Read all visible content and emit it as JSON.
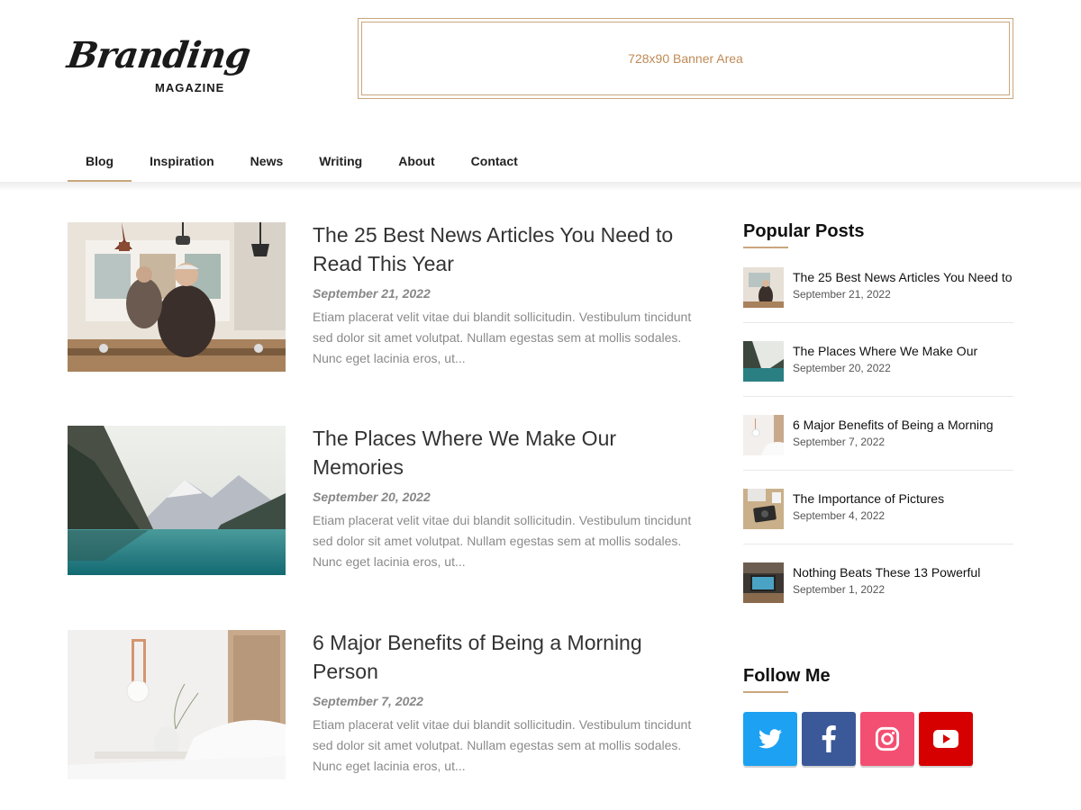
{
  "header": {
    "logo_script": "Branding",
    "logo_sub": "MAGAZINE",
    "banner_text": "728x90 Banner Area"
  },
  "nav": {
    "items": [
      {
        "label": "Blog",
        "active": true
      },
      {
        "label": "Inspiration"
      },
      {
        "label": "News"
      },
      {
        "label": "Writing"
      },
      {
        "label": "About"
      },
      {
        "label": "Contact"
      }
    ]
  },
  "posts": [
    {
      "title": "The 25 Best News Articles You Need to Read This Year",
      "date": "September 21, 2022",
      "excerpt": "Etiam placerat velit vitae dui blandit sollicitudin. Vestibulum tincidunt sed dolor sit amet volutpat. Nullam egestas sem at mollis sodales. Nunc eget lacinia eros, ut..."
    },
    {
      "title": "The Places Where We Make Our Memories",
      "date": "September 20, 2022",
      "excerpt": "Etiam placerat velit vitae dui blandit sollicitudin. Vestibulum tincidunt sed dolor sit amet volutpat. Nullam egestas sem at mollis sodales. Nunc eget lacinia eros, ut..."
    },
    {
      "title": "6 Major Benefits of Being a Morning Person",
      "date": "September 7, 2022",
      "excerpt": "Etiam placerat velit vitae dui blandit sollicitudin. Vestibulum tincidunt sed dolor sit amet volutpat. Nullam egestas sem at mollis sodales. Nunc eget lacinia eros, ut..."
    }
  ],
  "sidebar": {
    "popular_title": "Popular Posts",
    "popular": [
      {
        "title": "The 25 Best News Articles You Need to",
        "date": "September 21, 2022"
      },
      {
        "title": "The Places Where We Make Our",
        "date": "September 20, 2022"
      },
      {
        "title": "6 Major Benefits of Being a Morning",
        "date": "September 7, 2022"
      },
      {
        "title": "The Importance of Pictures",
        "date": "September 4, 2022"
      },
      {
        "title": "Nothing Beats These 13 Powerful",
        "date": "September 1, 2022"
      }
    ],
    "follow_title": "Follow Me",
    "social": [
      {
        "icon": "twitter-icon",
        "color": "#1da1f2"
      },
      {
        "icon": "facebook-icon",
        "color": "#3b5998"
      },
      {
        "icon": "instagram-icon",
        "color": "#f24f72"
      },
      {
        "icon": "youtube-icon",
        "color": "#d60000"
      }
    ]
  },
  "colors": {
    "accent": "#c9a67c"
  }
}
